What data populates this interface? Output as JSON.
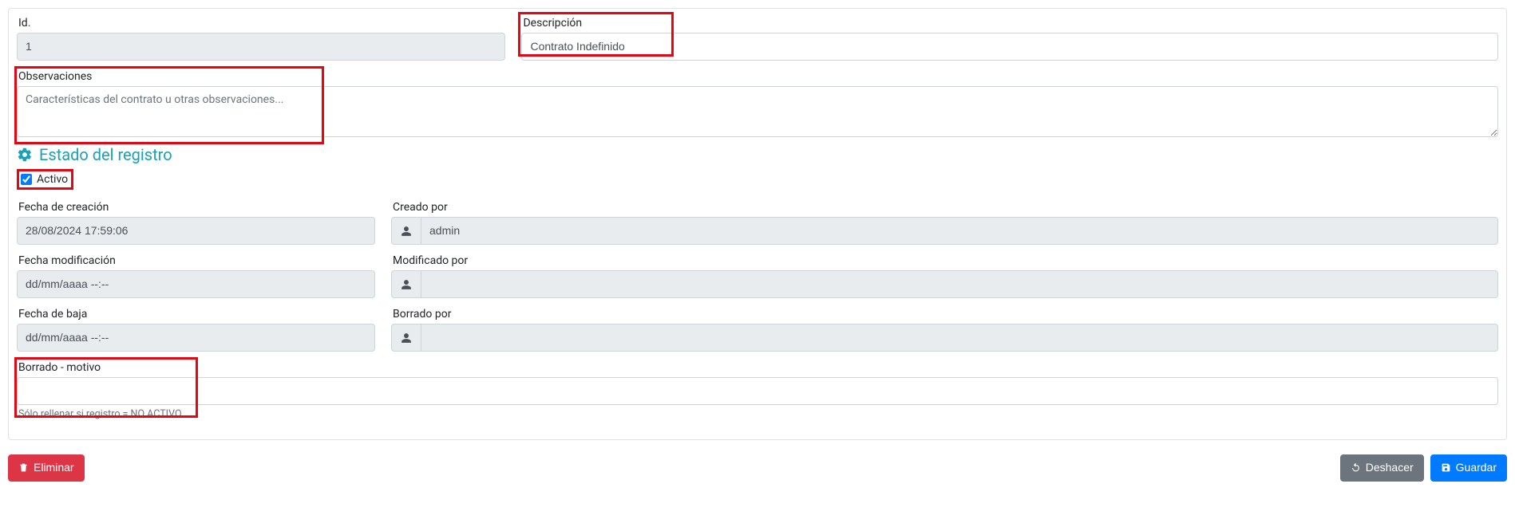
{
  "fields": {
    "id": {
      "label": "Id.",
      "value": "1"
    },
    "descripcion": {
      "label": "Descripción",
      "value": "Contrato Indefinido"
    },
    "observaciones": {
      "label": "Observaciones",
      "placeholder": "Características del contrato u otras observaciones...",
      "value": ""
    }
  },
  "estado": {
    "section_title": "Estado del registro",
    "activo_label": "Activo",
    "activo_checked": true,
    "fecha_creacion": {
      "label": "Fecha de creación",
      "value": "28/08/2024 17:59:06"
    },
    "creado_por": {
      "label": "Creado por",
      "value": "admin"
    },
    "fecha_modificacion": {
      "label": "Fecha modificación",
      "value": "dd/mm/aaaa --:--"
    },
    "modificado_por": {
      "label": "Modificado por",
      "value": ""
    },
    "fecha_baja": {
      "label": "Fecha de baja",
      "value": "dd/mm/aaaa --:--"
    },
    "borrado_por": {
      "label": "Borrado por",
      "value": ""
    },
    "borrado_motivo": {
      "label": "Borrado - motivo",
      "value": "",
      "help": "Sólo rellenar si registro = NO ACTIVO"
    }
  },
  "buttons": {
    "eliminar": "Eliminar",
    "deshacer": "Deshacer",
    "guardar": "Guardar"
  }
}
